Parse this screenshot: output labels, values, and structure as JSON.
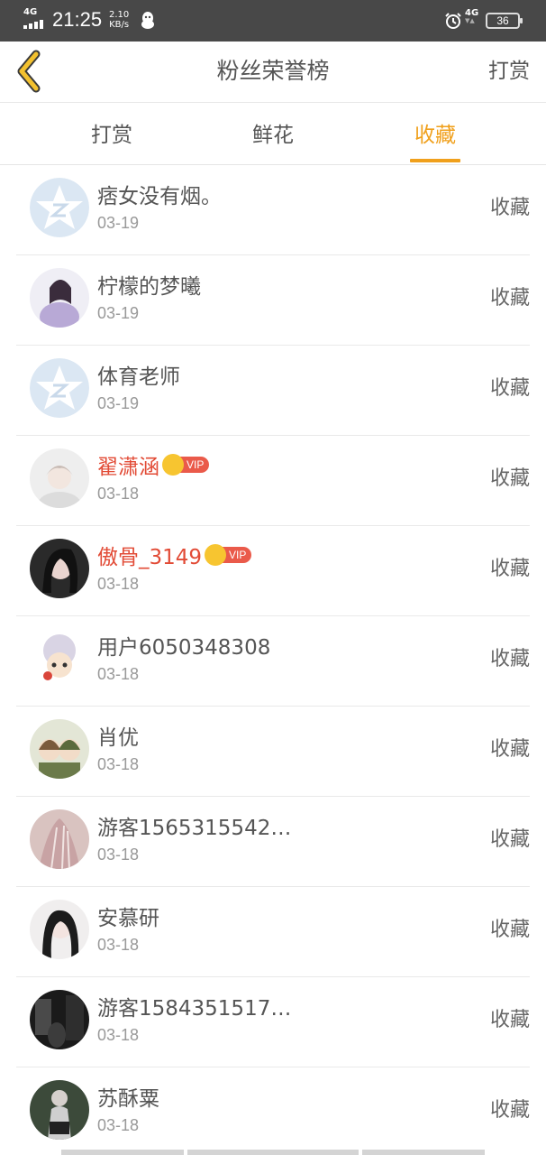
{
  "status_bar": {
    "network": "4G",
    "time": "21:25",
    "speed_value": "2.10",
    "speed_unit": "KB/s",
    "network2": "4G",
    "battery": "36",
    "icons": [
      "signal-icon",
      "qq-icon",
      "alarm-icon",
      "battery-icon"
    ]
  },
  "header": {
    "title": "粉丝荣誉榜",
    "right_action": "打赏",
    "back_icon": "chevron-left-icon"
  },
  "tabs": [
    {
      "label": "打赏",
      "active": false
    },
    {
      "label": "鲜花",
      "active": false
    },
    {
      "label": "收藏",
      "active": true
    }
  ],
  "accent_color": "#f0a01c",
  "vip_name_color": "#e24b36",
  "rows": [
    {
      "name": "痞女没有烟。",
      "date": "03-19",
      "action": "收藏",
      "vip": false,
      "avatar": "default-star-avatar"
    },
    {
      "name": "柠檬的梦曦",
      "date": "03-19",
      "action": "收藏",
      "vip": false,
      "avatar": "user-avatar"
    },
    {
      "name": "体育老师",
      "date": "03-19",
      "action": "收藏",
      "vip": false,
      "avatar": "default-star-avatar"
    },
    {
      "name": "翟潇涵",
      "date": "03-18",
      "action": "收藏",
      "vip": true,
      "vip_label": "VIP",
      "avatar": "user-avatar"
    },
    {
      "name": "傲骨_3149",
      "date": "03-18",
      "action": "收藏",
      "vip": true,
      "vip_label": "VIP",
      "avatar": "user-avatar"
    },
    {
      "name": "用户6050348308",
      "date": "03-18",
      "action": "收藏",
      "vip": false,
      "avatar": "user-avatar"
    },
    {
      "name": "肖优",
      "date": "03-18",
      "action": "收藏",
      "vip": false,
      "avatar": "user-avatar"
    },
    {
      "name": "游客1565315542…",
      "date": "03-18",
      "action": "收藏",
      "vip": false,
      "avatar": "user-avatar"
    },
    {
      "name": "安慕研",
      "date": "03-18",
      "action": "收藏",
      "vip": false,
      "avatar": "user-avatar"
    },
    {
      "name": "游客1584351517…",
      "date": "03-18",
      "action": "收藏",
      "vip": false,
      "avatar": "user-avatar"
    },
    {
      "name": "苏酥粟",
      "date": "03-18",
      "action": "收藏",
      "vip": false,
      "avatar": "user-avatar"
    }
  ]
}
